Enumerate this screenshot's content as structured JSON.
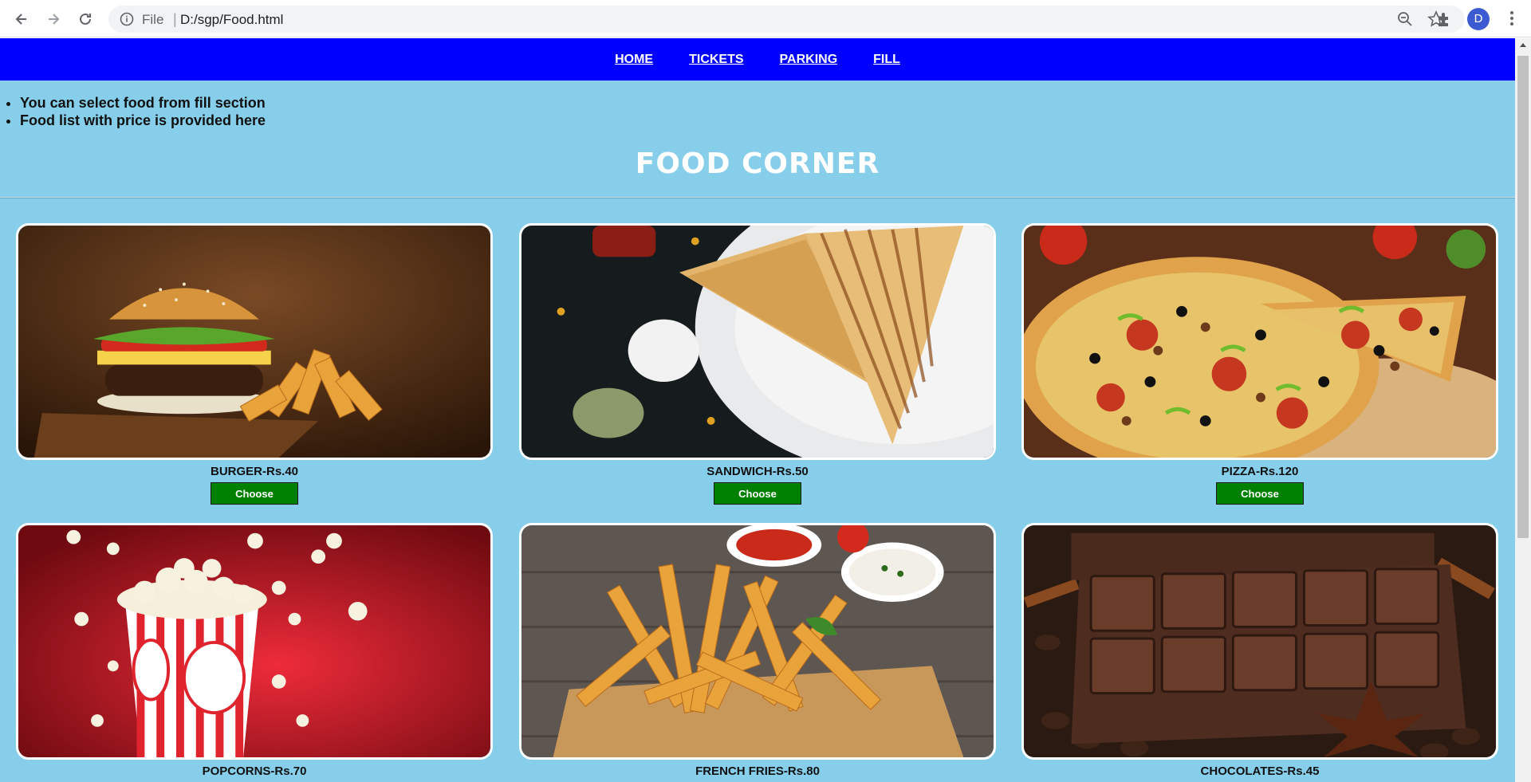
{
  "browser": {
    "scheme": "File",
    "url": "D:/sgp/Food.html",
    "profile_initial": "D"
  },
  "nav": {
    "items": [
      "HOME",
      "TICKETS",
      "PARKING",
      "FILL"
    ]
  },
  "info": {
    "bullets": [
      "You can select food from fill section",
      "Food list with price is provided here"
    ]
  },
  "page": {
    "title": "FOOD CORNER"
  },
  "foods": [
    {
      "label": "BURGER-Rs.40",
      "button": "Choose"
    },
    {
      "label": "SANDWICH-Rs.50",
      "button": "Choose"
    },
    {
      "label": "PIZZA-Rs.120",
      "button": "Choose"
    },
    {
      "label": "POPCORNS-Rs.70"
    },
    {
      "label": "FRENCH FRIES-Rs.80"
    },
    {
      "label": "CHOCOLATES-Rs.45"
    }
  ],
  "images": {
    "burger": "burger-photo",
    "sandwich": "sandwich-photo",
    "pizza": "pizza-photo",
    "popcorn": "popcorn-photo",
    "fries": "french-fries-photo",
    "chocolate": "chocolate-photo"
  },
  "colors": {
    "nav_bg": "#0000ff",
    "page_bg": "#87ceeb",
    "button_bg": "#008000"
  }
}
